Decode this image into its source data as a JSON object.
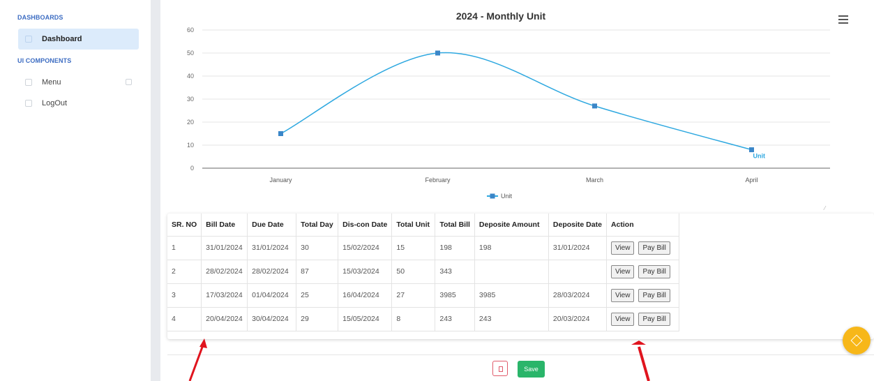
{
  "sidebar": {
    "heading_dashboards": "DASHBOARDS",
    "dashboard_label": "Dashboard",
    "heading_components": "UI COMPONENTS",
    "menu_label": "Menu",
    "logout_label": "LogOut"
  },
  "chart_data": {
    "type": "line",
    "title": "2024 - Monthly Unit",
    "xlabel": "",
    "ylabel": "Unit",
    "categories": [
      "January",
      "February",
      "March",
      "April"
    ],
    "series": [
      {
        "name": "Unit",
        "values": [
          15,
          50,
          27,
          8
        ]
      }
    ],
    "ylim": [
      0,
      60
    ],
    "yticks": [
      0,
      10,
      20,
      30,
      40,
      50,
      60
    ],
    "grid": true,
    "legend": "bottom",
    "end_label": "Unit",
    "color": "#2ea8e0"
  },
  "table": {
    "headers": [
      "SR. NO",
      "Bill Date",
      "Due Date",
      "Total Day",
      "Dis-con Date",
      "Total Unit",
      "Total Bill",
      "Deposite Amount",
      "Deposite Date",
      "Action"
    ],
    "rows": [
      [
        "1",
        "31/01/2024",
        "31/01/2024",
        "30",
        "15/02/2024",
        "15",
        "198",
        "198",
        "31/01/2024"
      ],
      [
        "2",
        "28/02/2024",
        "28/02/2024",
        "87",
        "15/03/2024",
        "50",
        "343",
        "",
        ""
      ],
      [
        "3",
        "17/03/2024",
        "01/04/2024",
        "25",
        "16/04/2024",
        "27",
        "3985",
        "3985",
        "28/03/2024"
      ],
      [
        "4",
        "20/04/2024",
        "30/04/2024",
        "29",
        "15/05/2024",
        "8",
        "243",
        "243",
        "20/03/2024"
      ]
    ],
    "view_label": "View",
    "pay_label": "Pay Bill"
  },
  "footer": {
    "save_label": "Save"
  },
  "colors": {
    "accent": "#3c6cc2",
    "save": "#2ab56a",
    "delete": "#e05a6a",
    "fab": "#f7b719",
    "annotation": "#e0141e"
  }
}
